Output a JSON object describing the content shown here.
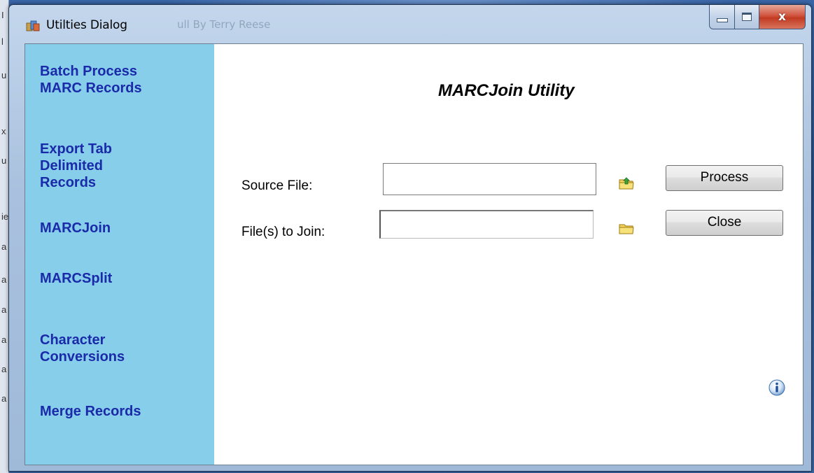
{
  "window": {
    "title": "Utilties Dialog",
    "title_ghost": "ull By Terry Reese",
    "close_glyph": "x"
  },
  "background_strip": [
    "I",
    "l",
    "u",
    "x",
    "u",
    "ie",
    "a",
    "a",
    "a",
    "a",
    "a",
    "a"
  ],
  "sidebar": {
    "items": [
      {
        "label": "Batch Process\nMARC Records"
      },
      {
        "label": "Export Tab\nDelimited\nRecords"
      },
      {
        "label": "MARCJoin"
      },
      {
        "label": "MARCSplit"
      },
      {
        "label": "Character\nConversions"
      },
      {
        "label": "Merge Records"
      }
    ]
  },
  "main": {
    "title": "MARCJoin Utility",
    "source_file": {
      "label": "Source File:",
      "value": ""
    },
    "join_files": {
      "label": "File(s) to Join:",
      "value": ""
    },
    "process_button": "Process",
    "close_button": "Close"
  },
  "icons": {
    "app": "app-icon",
    "open_file": "folder-open-arrow-icon",
    "folder": "folder-icon",
    "info": "info-icon"
  },
  "colors": {
    "sidebar_bg": "#87ceeb",
    "sidebar_text": "#1a2aa8",
    "close_button": "#c94a33"
  }
}
